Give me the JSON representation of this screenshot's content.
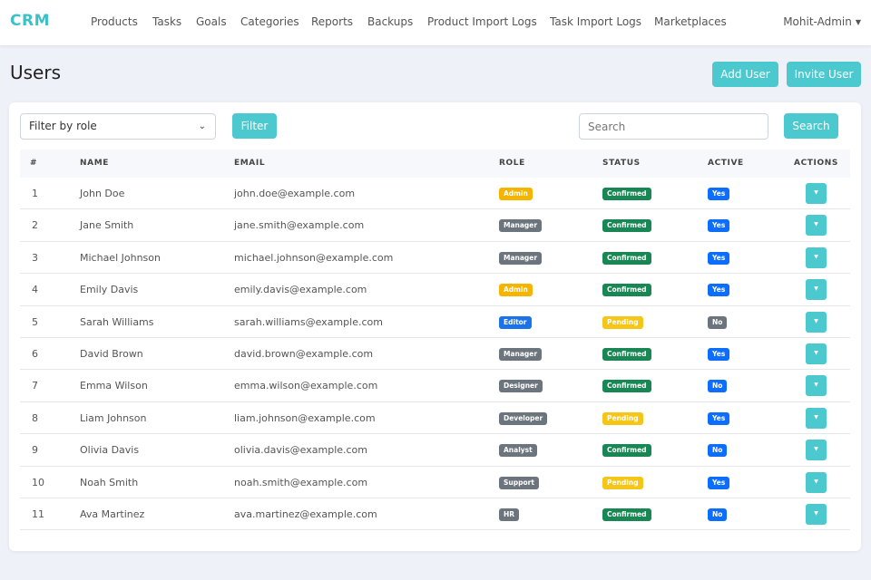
{
  "app": {
    "brand": "CRM"
  },
  "nav": {
    "items": [
      "Products",
      "Tasks",
      "Goals",
      "Categories",
      "Reports",
      "Backups",
      "Product Import Logs",
      "Task Import Logs",
      "Marketplaces"
    ],
    "user": "Mohit-Admin"
  },
  "page": {
    "title": "Users",
    "add_user_label": "Add User",
    "invite_user_label": "Invite User"
  },
  "filters": {
    "role_select_value": "Filter by role",
    "filter_label": "Filter",
    "search_placeholder": "Search",
    "search_label": "Search"
  },
  "table": {
    "columns": [
      "#",
      "NAME",
      "EMAIL",
      "ROLE",
      "STATUS",
      "ACTIVE",
      "ACTIONS"
    ],
    "rows": [
      {
        "num": "1",
        "name": "John Doe",
        "email": "john.doe@example.com",
        "role": "Admin",
        "status": "Confirmed",
        "active": "Yes"
      },
      {
        "num": "2",
        "name": "Jane Smith",
        "email": "jane.smith@example.com",
        "role": "Manager",
        "status": "Confirmed",
        "active": "Yes"
      },
      {
        "num": "3",
        "name": "Michael Johnson",
        "email": "michael.johnson@example.com",
        "role": "Manager",
        "status": "Confirmed",
        "active": "Yes"
      },
      {
        "num": "4",
        "name": "Emily Davis",
        "email": "emily.davis@example.com",
        "role": "Admin",
        "status": "Confirmed",
        "active": "Yes"
      },
      {
        "num": "5",
        "name": "Sarah Williams",
        "email": "sarah.williams@example.com",
        "role": "Editor",
        "status": "Pending",
        "active": "No"
      },
      {
        "num": "6",
        "name": "David Brown",
        "email": "david.brown@example.com",
        "role": "Manager",
        "status": "Confirmed",
        "active": "Yes"
      },
      {
        "num": "7",
        "name": "Emma Wilson",
        "email": "emma.wilson@example.com",
        "role": "Designer",
        "status": "Confirmed",
        "active": "No"
      },
      {
        "num": "8",
        "name": "Liam Johnson",
        "email": "liam.johnson@example.com",
        "role": "Developer",
        "status": "Pending",
        "active": "Yes"
      },
      {
        "num": "9",
        "name": "Olivia Davis",
        "email": "olivia.davis@example.com",
        "role": "Analyst",
        "status": "Confirmed",
        "active": "No"
      },
      {
        "num": "10",
        "name": "Noah Smith",
        "email": "noah.smith@example.com",
        "role": "Support",
        "status": "Pending",
        "active": "Yes"
      },
      {
        "num": "11",
        "name": "Ava Martinez",
        "email": "ava.martinez@example.com",
        "role": "HR",
        "status": "Confirmed",
        "active": "No"
      }
    ]
  },
  "colors": {
    "accent": "#4cc9cf",
    "brand": "#3ec0c8",
    "role_admin": "#f5b400",
    "role_editor": "#1a73e8",
    "role_default": "#6c757d",
    "status_confirmed": "#198754",
    "status_pending": "#f5c518",
    "active_yes": "#0d6efd",
    "active_no_inactive": "#6c757d"
  },
  "icons": {
    "user_menu_caret": "caret-down-icon",
    "select_chevron": "chevron-down-icon",
    "row_action": "caret-down-icon"
  }
}
